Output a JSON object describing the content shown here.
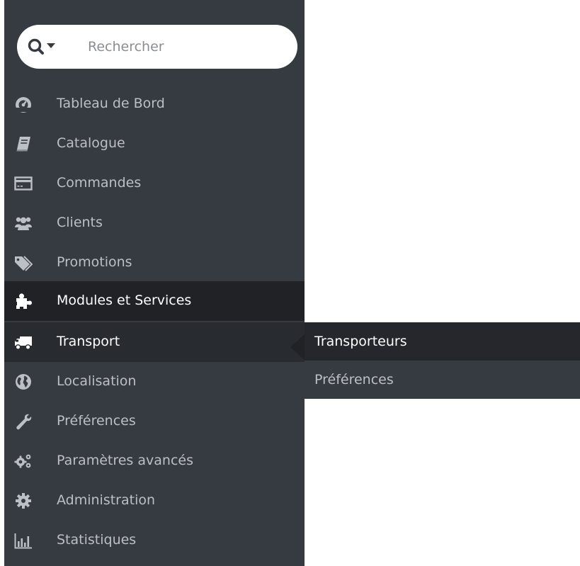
{
  "search": {
    "placeholder": "Rechercher"
  },
  "nav": {
    "items": [
      {
        "label": "Tableau de Bord",
        "icon": "dashboard-icon"
      },
      {
        "label": "Catalogue",
        "icon": "book-icon"
      },
      {
        "label": "Commandes",
        "icon": "credit-card-icon"
      },
      {
        "label": "Clients",
        "icon": "users-icon"
      },
      {
        "label": "Promotions",
        "icon": "tags-icon"
      },
      {
        "label": "Modules et Services",
        "icon": "puzzle-icon"
      },
      {
        "label": "Transport",
        "icon": "truck-icon"
      },
      {
        "label": "Localisation",
        "icon": "globe-icon"
      },
      {
        "label": "Préférences",
        "icon": "wrench-icon"
      },
      {
        "label": "Paramètres avancés",
        "icon": "cogs-icon"
      },
      {
        "label": "Administration",
        "icon": "gear-icon"
      },
      {
        "label": "Statistiques",
        "icon": "bar-chart-icon"
      }
    ]
  },
  "submenu": {
    "items": [
      {
        "label": "Transporteurs"
      },
      {
        "label": "Préférences"
      }
    ]
  },
  "colors": {
    "sidebar_bg": "#363a41",
    "hover_bg": "#202226",
    "active_bg": "#282b30",
    "text": "#bcbfc3",
    "text_active": "#ffffff"
  }
}
